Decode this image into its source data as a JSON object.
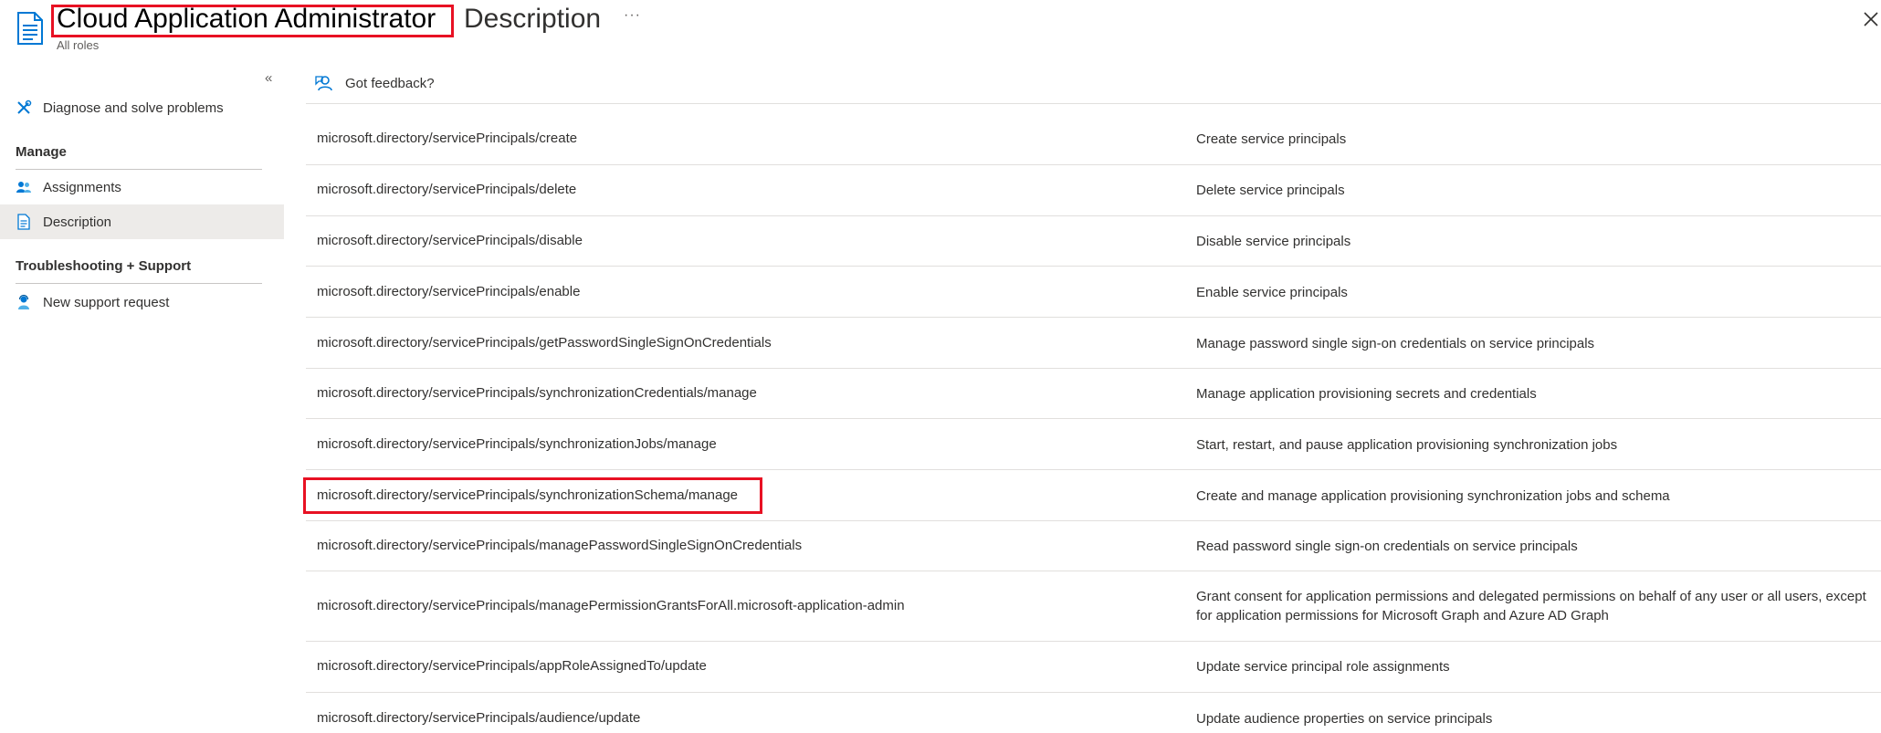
{
  "header": {
    "title": "Cloud Application Administrator",
    "title_suffix": "Description",
    "more": "···",
    "subtitle": "All roles"
  },
  "sidebar": {
    "collapse": "«",
    "items": [
      {
        "label": "Diagnose and solve problems",
        "icon": "wrench-icon"
      },
      {
        "label": "Assignments",
        "icon": "people-icon"
      },
      {
        "label": "Description",
        "icon": "document-icon"
      },
      {
        "label": "New support request",
        "icon": "support-person-icon"
      }
    ],
    "sections": [
      "Manage",
      "Troubleshooting + Support"
    ]
  },
  "main": {
    "feedback": "Got feedback?",
    "rows": [
      {
        "perm": "microsoft.directory/servicePrincipals/create",
        "desc": "Create service principals"
      },
      {
        "perm": "microsoft.directory/servicePrincipals/delete",
        "desc": "Delete service principals"
      },
      {
        "perm": "microsoft.directory/servicePrincipals/disable",
        "desc": "Disable service principals"
      },
      {
        "perm": "microsoft.directory/servicePrincipals/enable",
        "desc": "Enable service principals"
      },
      {
        "perm": "microsoft.directory/servicePrincipals/getPasswordSingleSignOnCredentials",
        "desc": "Manage password single sign-on credentials on service principals"
      },
      {
        "perm": "microsoft.directory/servicePrincipals/synchronizationCredentials/manage",
        "desc": "Manage application provisioning secrets and credentials"
      },
      {
        "perm": "microsoft.directory/servicePrincipals/synchronizationJobs/manage",
        "desc": "Start, restart, and pause application provisioning synchronization jobs"
      },
      {
        "perm": "microsoft.directory/servicePrincipals/synchronizationSchema/manage",
        "desc": "Create and manage application provisioning synchronization jobs and schema"
      },
      {
        "perm": "microsoft.directory/servicePrincipals/managePasswordSingleSignOnCredentials",
        "desc": "Read password single sign-on credentials on service principals"
      },
      {
        "perm": "microsoft.directory/servicePrincipals/managePermissionGrantsForAll.microsoft-application-admin",
        "desc": "Grant consent for application permissions and delegated permissions on behalf of any user or all users, except for application permissions for Microsoft Graph and Azure AD Graph"
      },
      {
        "perm": "microsoft.directory/servicePrincipals/appRoleAssignedTo/update",
        "desc": "Update service principal role assignments"
      },
      {
        "perm": "microsoft.directory/servicePrincipals/audience/update",
        "desc": "Update audience properties on service principals"
      }
    ]
  },
  "colors": {
    "accent": "#0078d4",
    "highlight": "#e81123"
  }
}
